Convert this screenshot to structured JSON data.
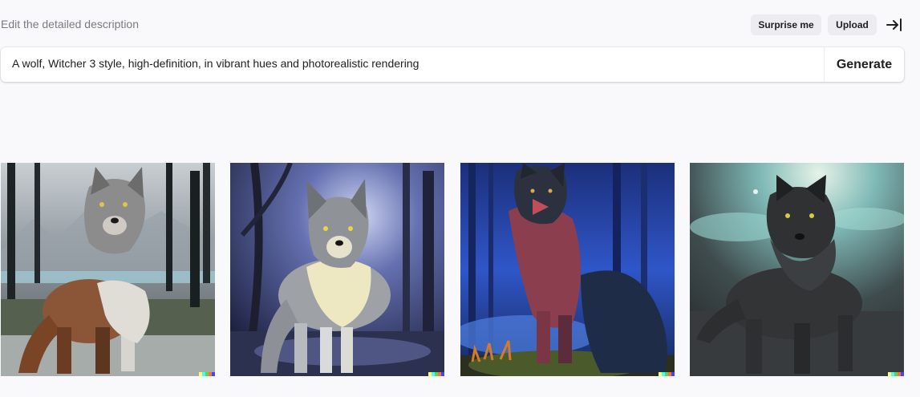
{
  "header": {
    "hint": "Edit the detailed description",
    "surprise_label": "Surprise me",
    "upload_label": "Upload",
    "collapse_icon": "arrow-right-to-bar-icon"
  },
  "prompt": {
    "value": "A wolf, Witcher 3 style, high-definition, in vibrant hues and photorealistic rendering",
    "generate_label": "Generate"
  },
  "results": [
    {
      "description": "Reddish-brown and grey wolf in misty forest with snowy ground"
    },
    {
      "description": "Grey and cream wolf in dark blue moonlit forest"
    },
    {
      "description": "Dark red and black wolf in glowing blue night forest"
    },
    {
      "description": "Black wolf with yellow eyes in foggy teal forest"
    }
  ],
  "signature_colors": [
    "#ffff66",
    "#42ffff",
    "#51da4c",
    "#ff6e3c",
    "#3c46ff"
  ],
  "colors": {
    "background": "#f9f9fb",
    "chip": "#ececf1",
    "text": "#202123",
    "muted": "#7a7b80"
  }
}
